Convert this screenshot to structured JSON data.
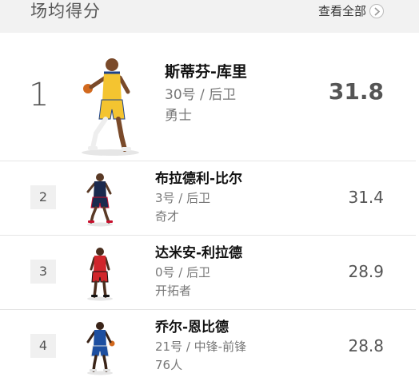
{
  "header": {
    "title": "场均得分",
    "view_all_label": "查看全部"
  },
  "leaders": [
    {
      "rank": "1",
      "name": "斯蒂芬-库里",
      "number_position": "30号 / 后卫",
      "team": "勇士",
      "value": "31.8",
      "jersey_color": "#f4c430",
      "trim_color": "#1d428a"
    },
    {
      "rank": "2",
      "name": "布拉德利-比尔",
      "number_position": "3号 / 后卫",
      "team": "奇才",
      "value": "31.4",
      "jersey_color": "#1b2a4e",
      "trim_color": "#c8102e"
    },
    {
      "rank": "3",
      "name": "达米安-利拉德",
      "number_position": "0号 / 后卫",
      "team": "开拓者",
      "value": "28.9",
      "jersey_color": "#d0262b",
      "trim_color": "#111111"
    },
    {
      "rank": "4",
      "name": "乔尔-恩比德",
      "number_position": "21号 / 中锋-前锋",
      "team": "76人",
      "value": "28.8",
      "jersey_color": "#1d4fa0",
      "trim_color": "#e0e0e0"
    }
  ]
}
